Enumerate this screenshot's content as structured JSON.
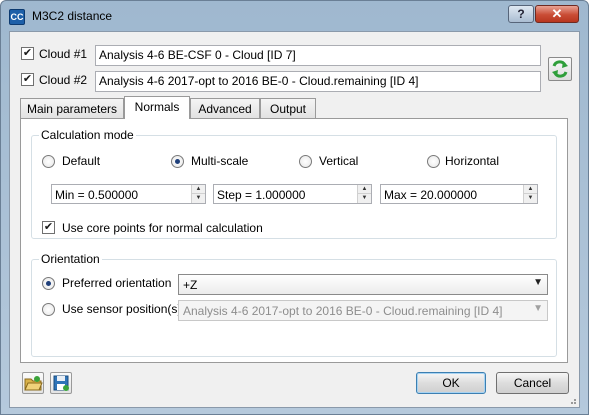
{
  "window": {
    "title": "M3C2 distance",
    "app_icon_text": "CC",
    "help_label": "?",
    "close_label": "✕"
  },
  "cloud1": {
    "label": "Cloud #1",
    "checked": true,
    "value": "Analysis 4-6 BE-CSF 0 - Cloud [ID 7]"
  },
  "cloud2": {
    "label": "Cloud #2",
    "checked": true,
    "value": "Analysis 4-6 2017-opt to 2016 BE-0 - Cloud.remaining [ID 4]"
  },
  "tabs": [
    {
      "label": "Main parameters",
      "active": false
    },
    {
      "label": "Normals",
      "active": true
    },
    {
      "label": "Advanced",
      "active": false
    },
    {
      "label": "Output",
      "active": false
    }
  ],
  "calculation_mode": {
    "title": "Calculation mode",
    "options": [
      {
        "label": "Default",
        "selected": false
      },
      {
        "label": "Multi-scale",
        "selected": true
      },
      {
        "label": "Vertical",
        "selected": false
      },
      {
        "label": "Horizontal",
        "selected": false
      }
    ],
    "min": "Min = 0.500000",
    "step": "Step = 1.000000",
    "max": "Max = 20.000000",
    "core_points": {
      "label": "Use core points for normal calculation",
      "checked": true
    }
  },
  "orientation": {
    "title": "Orientation",
    "preferred": {
      "label": "Preferred orientation",
      "selected": true,
      "value": "+Z"
    },
    "sensor": {
      "label": "Use sensor position(s)",
      "selected": false,
      "value": "Analysis 4-6 2017-opt to 2016 BE-0 - Cloud.remaining [ID 4]"
    }
  },
  "footer": {
    "ok_label": "OK",
    "cancel_label": "Cancel"
  },
  "icons": [
    "app-icon",
    "help-icon",
    "close-icon",
    "swap-clouds-icon",
    "load-params-icon",
    "save-params-icon",
    "spin-up-icon",
    "spin-down-icon",
    "dropdown-arrow-icon",
    "checkmark-icon"
  ],
  "colors": {
    "title_bar": "#a9bfd4",
    "close_button": "#c94c35",
    "default_button_border": "#3c7fb1",
    "swap_icon": "#2e9e3a"
  }
}
